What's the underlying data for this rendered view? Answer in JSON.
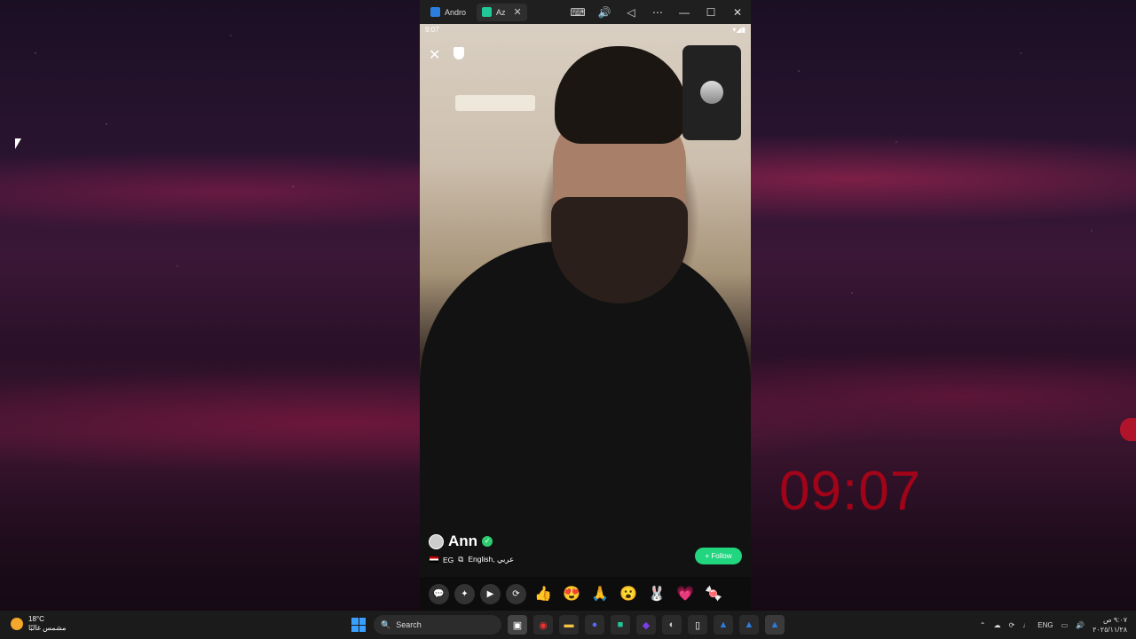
{
  "emulator": {
    "tabs": [
      {
        "label": "Andro",
        "active": false
      },
      {
        "label": "Az",
        "active": true
      }
    ],
    "toolbar": [
      "keyboard-icon",
      "volume-icon",
      "back-icon",
      "more-icon",
      "minimize-icon",
      "maximize-icon",
      "close-icon"
    ]
  },
  "phone": {
    "status_time": "9:07",
    "user": {
      "name": "Ann",
      "country": "EG",
      "languages": "English, عربي"
    },
    "follow_label": "+ Follow",
    "bottom_buttons": [
      "chat-icon",
      "magic-wand-icon",
      "camera-icon",
      "switch-icon"
    ],
    "gifts": [
      "👍",
      "😍",
      "🙏",
      "😮",
      "🐰",
      "💗",
      "🍬",
      "🍭"
    ]
  },
  "desktop": {
    "clock": "09:07"
  },
  "taskbar": {
    "weather_temp": "18°C",
    "weather_desc": "مشمس غالبًا",
    "search_label": "Search",
    "language": "ENG",
    "time": "٩:٠٧ ص",
    "date": "٢٠٢٥/١١/٢٨"
  }
}
